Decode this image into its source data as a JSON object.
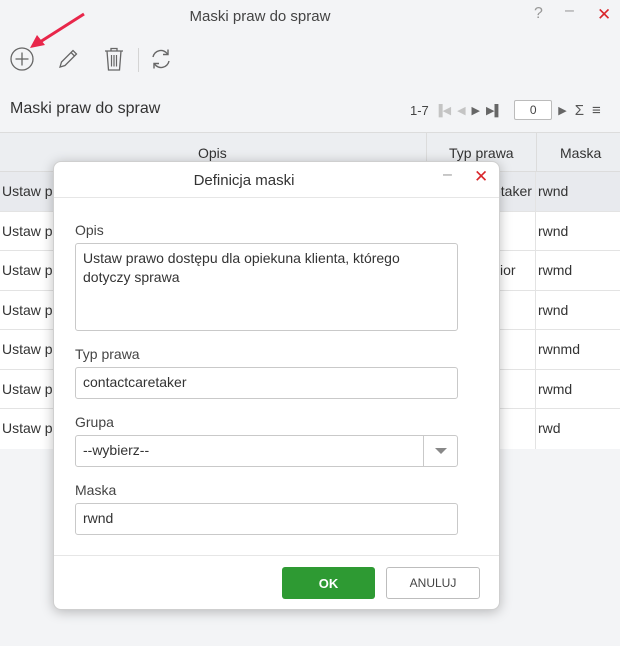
{
  "window": {
    "title": "Maski praw do spraw",
    "help": "?",
    "minimize": "–",
    "close": "✕"
  },
  "section": {
    "title": "Maski praw do spraw"
  },
  "pager": {
    "range": "1-7",
    "page": "0",
    "sum": "Σ",
    "menu": "≡"
  },
  "grid": {
    "columns": [
      "Opis",
      "Typ prawa",
      "Maska"
    ],
    "rows": [
      {
        "opis": "Ustaw p",
        "typ": "etaker",
        "maska": "rwnd"
      },
      {
        "opis": "Ustaw p",
        "typ": "",
        "maska": "rwnd"
      },
      {
        "opis": "Ustaw p",
        "typ": "ior",
        "maska": "rwmd"
      },
      {
        "opis": "Ustaw p",
        "typ": "",
        "maska": "rwnd"
      },
      {
        "opis": "Ustaw p",
        "typ": "",
        "maska": "rwnmd"
      },
      {
        "opis": "Ustaw p",
        "typ": "",
        "maska": "rwmd"
      },
      {
        "opis": "Ustaw p",
        "typ": "",
        "maska": "rwd"
      }
    ]
  },
  "dialog": {
    "title": "Definicja maski",
    "minimize": "–",
    "close": "✕",
    "opis_label": "Opis",
    "opis_value": "Ustaw prawo dostępu dla opiekuna klienta, którego dotyczy sprawa",
    "typ_label": "Typ prawa",
    "typ_value": "contactcaretaker",
    "grupa_label": "Grupa",
    "grupa_value": "--wybierz--",
    "maska_label": "Maska",
    "maska_value": "rwnd",
    "ok": "OK",
    "cancel": "ANULUJ"
  },
  "colors": {
    "accent_green": "#2e9a33",
    "close_red": "#d9262b",
    "arrow_red": "#e8264a"
  }
}
